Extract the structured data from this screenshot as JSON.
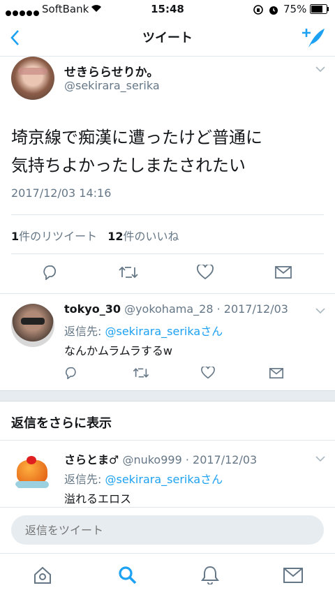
{
  "status_bar": {
    "carrier": "SoftBank",
    "time": "15:48",
    "battery": "75%"
  },
  "nav": {
    "title": "ツイート",
    "back_icon": "chevron-left-icon",
    "compose_icon": "compose-tweet-icon"
  },
  "tweet": {
    "display_name": "せきららせりか。",
    "handle": "@sekirara_serika",
    "text_line1": "埼京線で痴漢に遭ったけど普通に",
    "text_line2": "気持ちよかったしまたされたい",
    "timestamp": "2017/12/03 14:16",
    "retweets_count": "1",
    "retweets_label": "件のリツイート",
    "likes_count": "12",
    "likes_label": "件のいいね"
  },
  "replies": [
    {
      "display_name": "tokyo_30",
      "handle_date": "@yokohama_28 · 2017/12/03",
      "reply_prefix": "返信先: ",
      "reply_to": "@sekirara_serikaさん",
      "text": "なんかムラムラするw"
    },
    {
      "display_name": "さらとま♂",
      "handle_date": "@nuko999 · 2017/12/03",
      "reply_prefix": "返信先: ",
      "reply_to": "@sekirara_serikaさん",
      "text": "溢れるエロス"
    }
  ],
  "more_replies_heading": "返信をさらに表示",
  "reply_input": {
    "placeholder": "返信をツイート"
  },
  "colors": {
    "accent": "#1da1f2",
    "text": "#14171a",
    "muted": "#657786",
    "divider": "#e1e8ed",
    "section_bg": "#e6ecf0"
  }
}
